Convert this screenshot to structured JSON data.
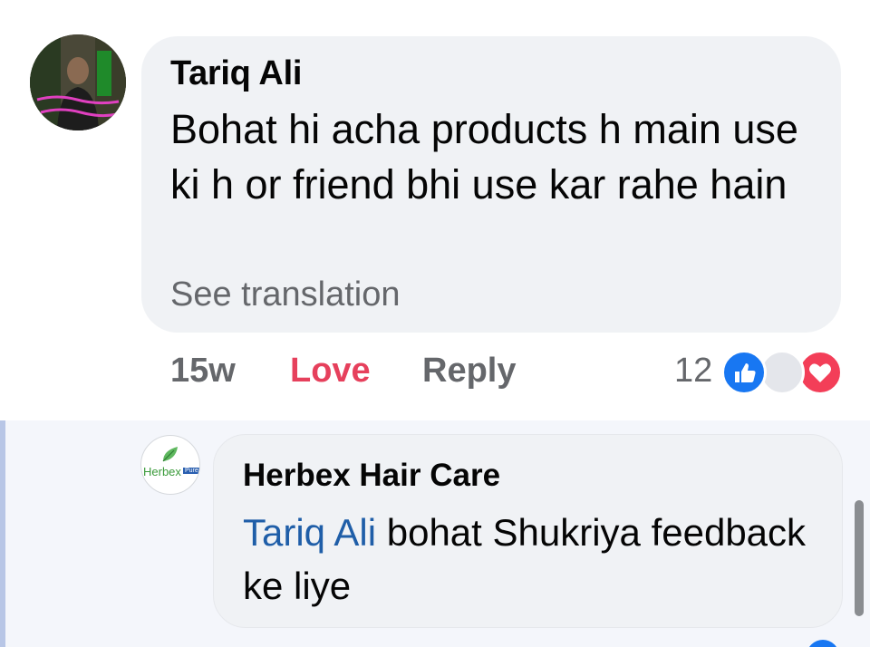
{
  "comment": {
    "author": "Tariq Ali",
    "text": "Bohat hi acha products h main use ki h or friend bhi use kar rahe hain",
    "see_translation": "See translation",
    "time": "15w",
    "reaction_label": "Love",
    "reply_label": "Reply",
    "reaction_count": "12",
    "reactions": [
      "like-icon",
      "care-icon",
      "love-icon"
    ]
  },
  "reply": {
    "author": "Herbex Hair Care",
    "mention": "Tariq Ali",
    "text": " bohat Shukriya feedback ke liye",
    "logo_text": "Herbex",
    "logo_badge": "Pure"
  },
  "colors": {
    "bubble": "#f0f2f5",
    "love": "#e6405c",
    "secondary_text": "#65676b",
    "like_blue": "#1877f2",
    "mention": "#1f5ea8"
  }
}
